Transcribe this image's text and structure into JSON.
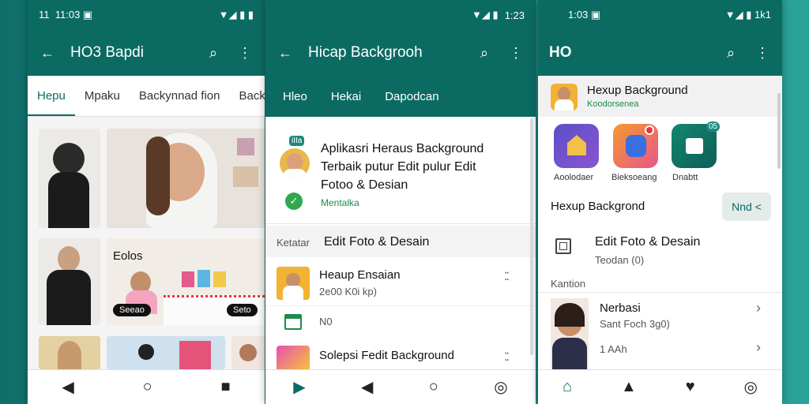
{
  "phone1": {
    "status": {
      "time": "11:03",
      "left_prefix": "11"
    },
    "appbar": {
      "back": "←",
      "title": "HO3 Bapdi",
      "search": "⌕",
      "menu": "⋮"
    },
    "tabs": [
      "Hepu",
      "Mpaku",
      "Backynnad fion",
      "Back"
    ],
    "tiles": {
      "label_a": "Eolos",
      "pill_a": "Seeao",
      "pill_b": "Seto"
    },
    "nav": [
      "◀",
      "○",
      "■"
    ]
  },
  "phone2": {
    "status": {
      "time": "1:23"
    },
    "appbar": {
      "back": "←",
      "title": "Hicap Backgrooh",
      "search": "⌕",
      "menu": "⋮"
    },
    "tabs": [
      "Hleo",
      "Hekai",
      "Dapodcan"
    ],
    "card": {
      "badge": "iIIa",
      "title_l1": "Aplikasri Heraus Background",
      "title_l2": "Terbaik putur Edit pulur Edit",
      "title_l3": "Fotoo & Desian",
      "sub": "Mentalka"
    },
    "section": {
      "label": "Ketatar",
      "title": "Edit Foto & Desain"
    },
    "items": [
      {
        "title": "Heaup Ensaian",
        "sub": "2e00 K0i kp)"
      },
      {
        "title": "N0",
        "sub": ""
      },
      {
        "title": "Solepsi Fedit Background",
        "sub": ""
      }
    ],
    "nav": [
      "▶",
      "◀",
      "○",
      "◎"
    ]
  },
  "phone3": {
    "status": {
      "time": "1:03",
      "right": "1k1"
    },
    "appbar": {
      "logo": "HO",
      "search": "⌕",
      "menu": "⋮"
    },
    "header": {
      "title": "Hexup Background",
      "sub": "Koodorsenea"
    },
    "apps": [
      {
        "label": "Aoolodaer"
      },
      {
        "label": "Bieksoeang"
      },
      {
        "label": "Dnabtt"
      }
    ],
    "app3_badge": "05",
    "banner": {
      "title": "Hexup Backgrond",
      "button": "Nnd <"
    },
    "edit_row": {
      "title": "Edit Foto & Desain",
      "sub": "Teodan (0)"
    },
    "section_label": "Kantion",
    "profile": {
      "name": "Nerbasi",
      "sub": "Sant Foch 3g0)",
      "meta": "1 AAh"
    },
    "nav": [
      "⌂",
      "▲",
      "♥",
      "◎"
    ]
  },
  "colors": {
    "primary": "#0b6b63",
    "accent": "#1c8c4a"
  }
}
